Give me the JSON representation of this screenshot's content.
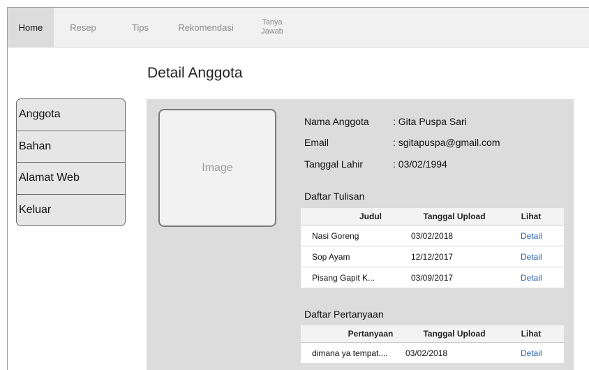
{
  "nav": {
    "tabs": [
      {
        "label": "Home"
      },
      {
        "label": "Resep"
      },
      {
        "label": "Tips"
      },
      {
        "label": "Rekomendasi"
      },
      {
        "label_line1": "Tanya",
        "label_line2": "Jawab"
      }
    ],
    "active": "Home"
  },
  "page_title": "Detail Anggota",
  "sidebar": {
    "items": [
      {
        "label": "Anggota"
      },
      {
        "label": "Bahan"
      },
      {
        "label": "Alamat Web"
      },
      {
        "label": "Keluar"
      }
    ]
  },
  "profile": {
    "image_placeholder": "Image",
    "fields": [
      {
        "label": "Nama Anggota",
        "value": ": Gita Puspa Sari"
      },
      {
        "label": "Email",
        "value": ": sgitapuspa@gmail.com"
      },
      {
        "label": "Tanggal Lahir",
        "value": ": 03/02/1994"
      }
    ]
  },
  "tulisan": {
    "title": "Daftar Tulisan",
    "columns": [
      "Judul",
      "Tanggal Upload",
      "Lihat"
    ],
    "rows": [
      {
        "judul": "Nasi Goreng",
        "tanggal": "03/02/2018",
        "lihat": "Detail"
      },
      {
        "judul": "Sop Ayam",
        "tanggal": "12/12/2017",
        "lihat": "Detail"
      },
      {
        "judul": "Pisang Gapit K...",
        "tanggal": "03/09/2017",
        "lihat": "Detail"
      }
    ]
  },
  "pertanyaan": {
    "title": "Daftar Pertanyaan",
    "columns": [
      "Pertanyaan",
      "Tanggal Upload",
      "Lihat"
    ],
    "rows": [
      {
        "pertanyaan": "dimana ya tempat....",
        "tanggal": "03/02/2018",
        "lihat": "Detail"
      }
    ]
  },
  "colors": {
    "panel": "#dcdcdc",
    "link": "#2a63b8",
    "active_tab": "#dcdcdc"
  }
}
